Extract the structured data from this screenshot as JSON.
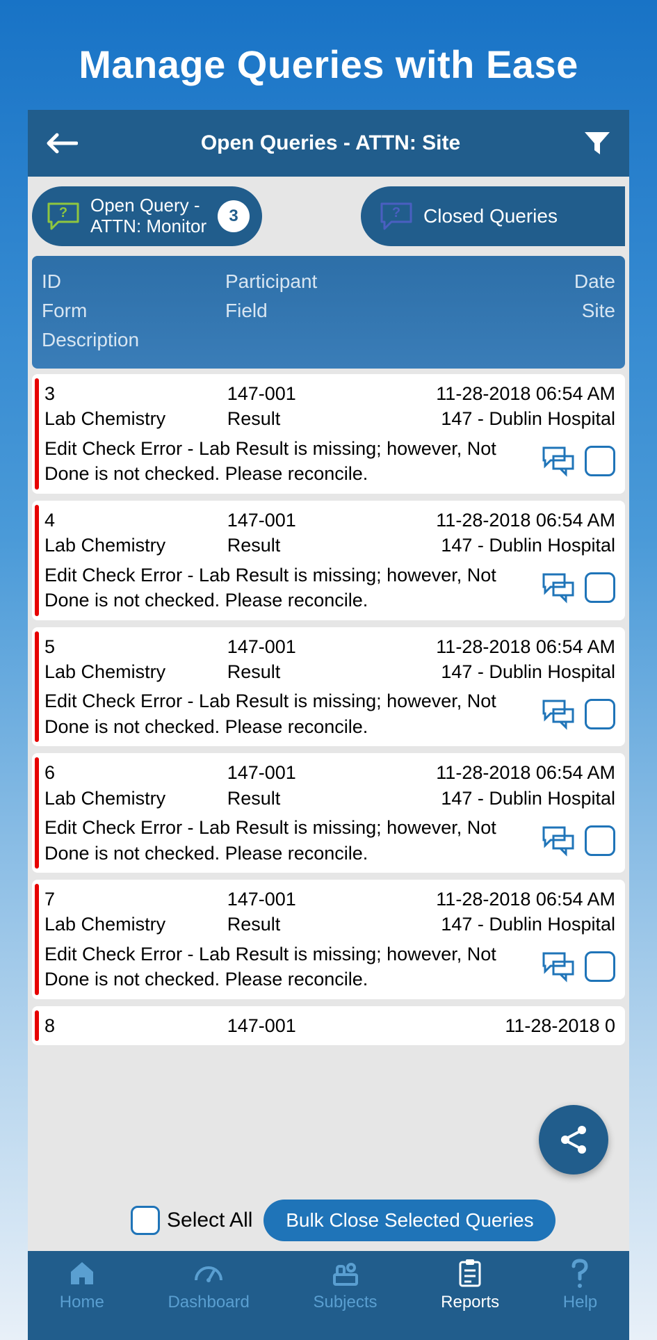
{
  "outer_title": "Manage Queries with Ease",
  "topbar": {
    "title": "Open Queries - ATTN: Site"
  },
  "pills": {
    "open": {
      "label": "Open Query -\nATTN: Monitor",
      "badge": "3"
    },
    "closed": {
      "label": "Closed Queries"
    }
  },
  "list_header": {
    "c1": "ID",
    "c2": "Participant",
    "c3": "Date",
    "c4": "Form",
    "c5": "Field",
    "c6": "Site",
    "desc": "Description"
  },
  "rows": [
    {
      "id": "3",
      "participant": "147-001",
      "date": "11-28-2018 06:54 AM",
      "form": "Lab Chemistry",
      "field": "Result",
      "site": "147 - Dublin Hospital",
      "desc": "Edit Check Error - Lab Result is missing; however, Not Done is not checked.  Please reconcile."
    },
    {
      "id": "4",
      "participant": "147-001",
      "date": "11-28-2018 06:54 AM",
      "form": "Lab Chemistry",
      "field": "Result",
      "site": "147 - Dublin Hospital",
      "desc": "Edit Check Error - Lab Result is missing; however, Not Done is not checked.  Please reconcile."
    },
    {
      "id": "5",
      "participant": "147-001",
      "date": "11-28-2018 06:54 AM",
      "form": "Lab Chemistry",
      "field": "Result",
      "site": "147 - Dublin Hospital",
      "desc": "Edit Check Error - Lab Result is missing; however, Not Done is not checked.  Please reconcile."
    },
    {
      "id": "6",
      "participant": "147-001",
      "date": "11-28-2018 06:54 AM",
      "form": "Lab Chemistry",
      "field": "Result",
      "site": "147 - Dublin Hospital",
      "desc": "Edit Check Error - Lab Result is missing; however, Not Done is not checked.  Please reconcile."
    },
    {
      "id": "7",
      "participant": "147-001",
      "date": "11-28-2018 06:54 AM",
      "form": "Lab Chemistry",
      "field": "Result",
      "site": "147 - Dublin Hospital",
      "desc": "Edit Check Error - Lab Result is missing; however, Not Done is not checked.  Please reconcile."
    },
    {
      "id": "8",
      "participant": "147-001",
      "date": "11-28-2018 0",
      "form": "",
      "field": "",
      "site": "",
      "desc": ""
    }
  ],
  "actionbar": {
    "select_all": "Select All",
    "bulk_close": "Bulk Close Selected Queries"
  },
  "nav": {
    "home": "Home",
    "dashboard": "Dashboard",
    "subjects": "Subjects",
    "reports": "Reports",
    "help": "Help"
  }
}
